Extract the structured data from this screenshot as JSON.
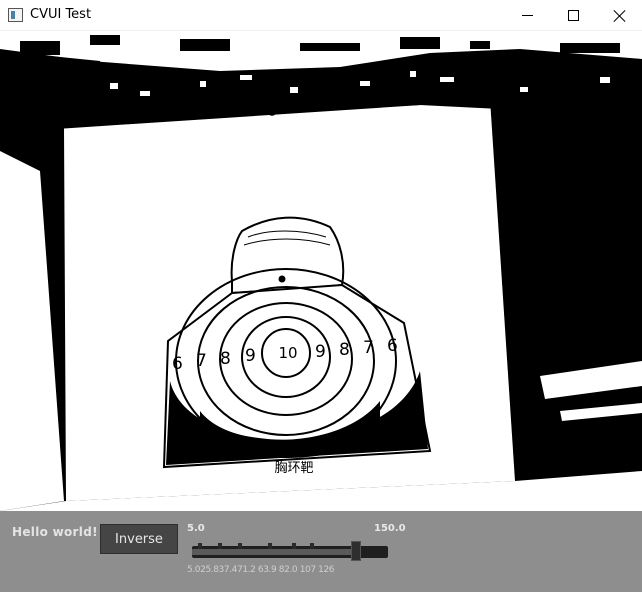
{
  "window": {
    "title": "CVUI Test",
    "icon": "app-window-icon",
    "controls": [
      "minimize-icon",
      "maximize-icon",
      "close-icon"
    ]
  },
  "target": {
    "center_label": "10",
    "left_rings": [
      "6",
      "7",
      "8",
      "9"
    ],
    "right_rings": [
      "9",
      "8",
      "7",
      "6"
    ],
    "bottom_text": "胸环靶"
  },
  "panel": {
    "hello_text": "Hello world!",
    "inverse_button": "Inverse",
    "trackbar": {
      "min_label": "5.0",
      "max_label": "150.0",
      "min": 5.0,
      "max": 150.0,
      "value": 126.0,
      "ticks_text": "5.025.837.471.2 63.9 82.0 107 126"
    }
  },
  "colors": {
    "panel_bg": "#8e8e8e",
    "button_bg": "#454545",
    "text_light": "#e4e4e4"
  }
}
